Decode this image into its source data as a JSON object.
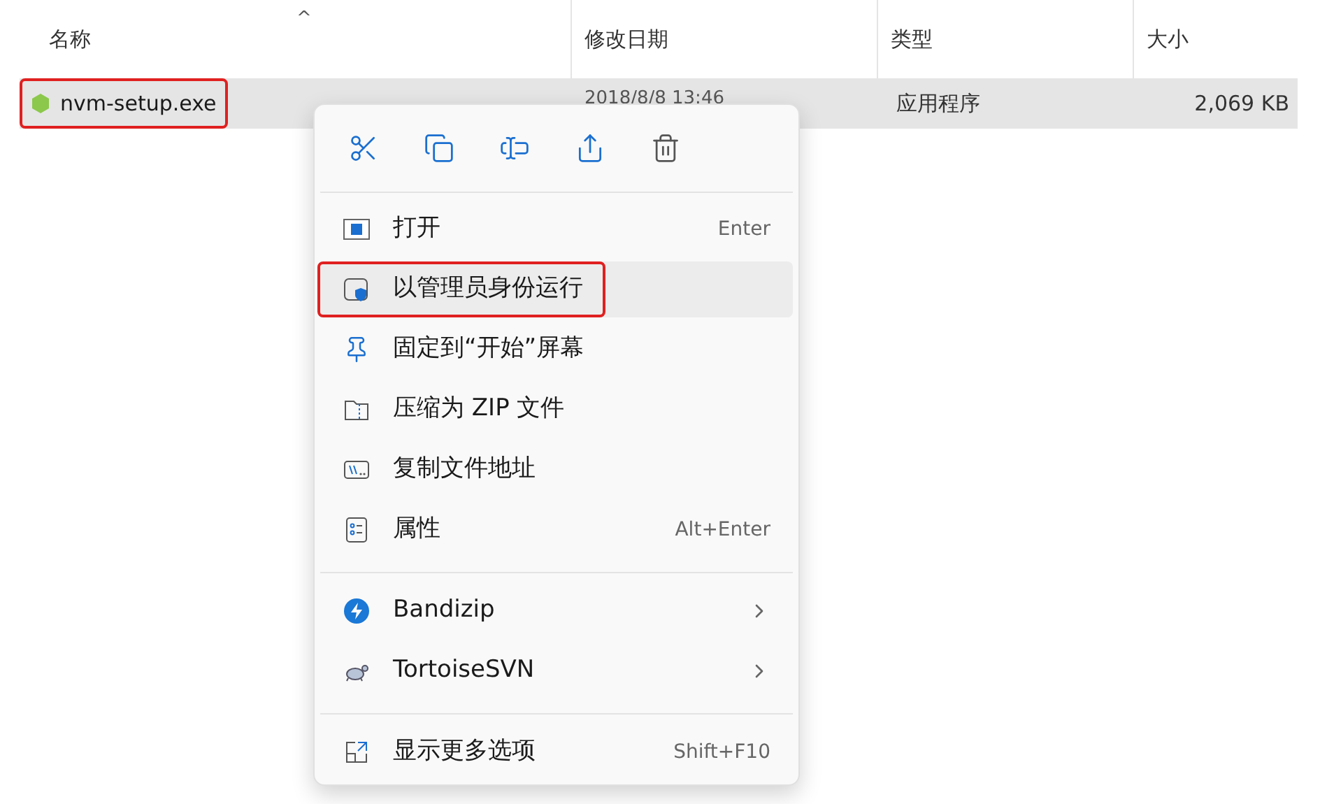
{
  "columns": [
    {
      "label": "名称"
    },
    {
      "label": "修改日期"
    },
    {
      "label": "类型"
    },
    {
      "label": "大小"
    }
  ],
  "sort_indicator": "^",
  "file": {
    "name": "nvm-setup.exe",
    "date": "2018/8/8 13:46",
    "type": "应用程序",
    "size": "2,069 KB",
    "selected": true,
    "annotated": true
  },
  "menu": {
    "actions": [
      {
        "kind": "cut"
      },
      {
        "kind": "copy"
      },
      {
        "kind": "rename"
      },
      {
        "kind": "share"
      },
      {
        "kind": "delete"
      }
    ],
    "items": [
      {
        "kind": "item",
        "label": "打开",
        "shortcut": "Enter",
        "hovered": false,
        "annotated": false,
        "submenu": false
      },
      {
        "kind": "item",
        "label": "以管理员身份运行",
        "hovered": true,
        "annotated": true,
        "submenu": false
      },
      {
        "kind": "item",
        "label": "固定到“开始”屏幕",
        "hovered": false,
        "annotated": false,
        "submenu": false
      },
      {
        "kind": "item",
        "label": "压缩为 ZIP 文件",
        "hovered": false,
        "annotated": false,
        "submenu": false
      },
      {
        "kind": "item",
        "label": "复制文件地址",
        "hovered": false,
        "annotated": false,
        "submenu": false
      },
      {
        "kind": "item",
        "label": "属性",
        "shortcut": "Alt+Enter",
        "hovered": false,
        "annotated": false,
        "submenu": false
      },
      {
        "kind": "separator"
      },
      {
        "kind": "item",
        "label": "Bandizip",
        "hovered": false,
        "annotated": false,
        "submenu": true
      },
      {
        "kind": "item",
        "label": "TortoiseSVN",
        "hovered": false,
        "annotated": false,
        "submenu": true
      },
      {
        "kind": "separator"
      },
      {
        "kind": "item",
        "label": "显示更多选项",
        "shortcut": "Shift+F10",
        "hovered": false,
        "annotated": false,
        "submenu": false
      }
    ]
  }
}
